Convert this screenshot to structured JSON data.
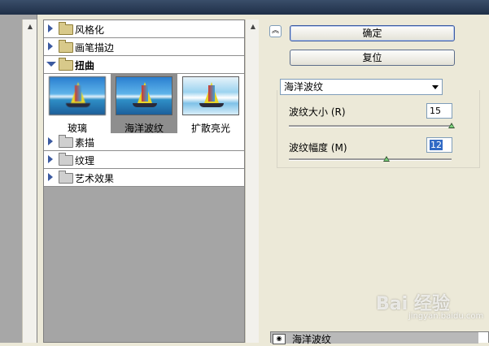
{
  "gallery": {
    "categories_top": [
      {
        "label": "风格化",
        "expanded": false
      },
      {
        "label": "画笔描边",
        "expanded": false
      },
      {
        "label": "扭曲",
        "expanded": true
      }
    ],
    "thumbnails": [
      {
        "label": "玻璃",
        "selected": false
      },
      {
        "label": "海洋波纹",
        "selected": true
      },
      {
        "label": "扩散亮光",
        "selected": false
      }
    ],
    "categories_bottom": [
      {
        "label": "素描",
        "expanded": false
      },
      {
        "label": "纹理",
        "expanded": false
      },
      {
        "label": "艺术效果",
        "expanded": false
      }
    ]
  },
  "buttons": {
    "ok": "确定",
    "reset": "复位"
  },
  "filter_select": {
    "value": "海洋波纹"
  },
  "params": [
    {
      "label": "波纹大小",
      "hotkey": "(R)",
      "value": "15",
      "slider_fraction": 1.0
    },
    {
      "label": "波纹幅度",
      "hotkey": "(M)",
      "value": "12",
      "slider_fraction": 0.6
    }
  ],
  "layer": {
    "name": "海洋波纹"
  },
  "watermark": {
    "text": "Bai 经验",
    "sub": "jingyan.baidu.com"
  },
  "colors": {
    "accent": "#3b5aa0",
    "selection": "#316ac5",
    "panel_bg": "#ece9d8"
  }
}
